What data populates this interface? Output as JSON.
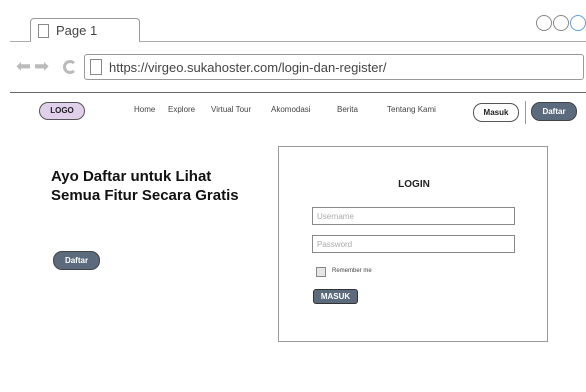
{
  "browser": {
    "tab_title": "Page 1",
    "url": "https://virgeo.sukahoster.com/login-dan-register/"
  },
  "header": {
    "logo_label": "LOGO",
    "menu": [
      {
        "label": "Home"
      },
      {
        "label": "Explore"
      },
      {
        "label": "Virtual Tour"
      },
      {
        "label": "Akomodasi"
      },
      {
        "label": "Berita"
      },
      {
        "label": "Tentang Kami"
      }
    ],
    "masuk_label": "Masuk",
    "daftar_label": "Daftar"
  },
  "hero": {
    "title": "Ayo Daftar untuk Lihat Semua Fitur Secara Gratis",
    "button_label": "Daftar"
  },
  "login": {
    "title": "LOGIN",
    "username_placeholder": "Username",
    "password_placeholder": "Password",
    "remember_label": "Remember me",
    "submit_label": "MASUK"
  },
  "colors": {
    "logo_bg": "#e0d0ec",
    "button_dark": "#5b6a7d"
  }
}
